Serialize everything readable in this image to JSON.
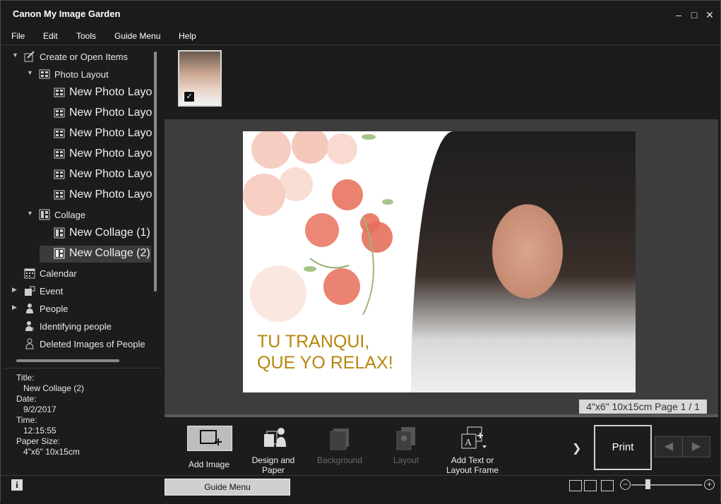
{
  "window": {
    "title": "Canon My Image Garden"
  },
  "menu": [
    "File",
    "Edit",
    "Tools",
    "Guide Menu",
    "Help"
  ],
  "tree": {
    "create_open": "Create or Open Items",
    "photo_layout": "Photo Layout",
    "photo_layout_items": [
      "New Photo Layo",
      "New Photo Layo",
      "New Photo Layo",
      "New Photo Layo",
      "New Photo Layo",
      "New Photo Layo"
    ],
    "collage": "Collage",
    "collage_items": [
      "New Collage (1)",
      "New Collage (2)"
    ],
    "calendar": "Calendar",
    "event": "Event",
    "people": "People",
    "identifying": "Identifying people",
    "deleted": "Deleted Images of People"
  },
  "info": {
    "title_label": "Title:",
    "title_value": "New Collage (2)",
    "date_label": "Date:",
    "date_value": "9/2/2017",
    "time_label": "Time:",
    "time_value": "12:15:55",
    "paper_label": "Paper Size:",
    "paper_value": "4\"x6\" 10x15cm"
  },
  "page": {
    "quote_line1": "TU TRANQUI,",
    "quote_line2": "QUE YO RELAX!",
    "page_info": "4\"x6\" 10x15cm Page 1 / 1"
  },
  "toolbar": {
    "add_image": "Add Image",
    "design_paper_1": "Design and",
    "design_paper_2": "Paper",
    "background": "Background",
    "layout": "Layout",
    "add_text_1": "Add Text or",
    "add_text_2": "Layout Frame",
    "print": "Print"
  },
  "status": {
    "guide_menu": "Guide Menu"
  },
  "colors": {
    "quote": "#b8860b",
    "bg": "#1c1c1c",
    "canvas": "#3d3d3d"
  }
}
